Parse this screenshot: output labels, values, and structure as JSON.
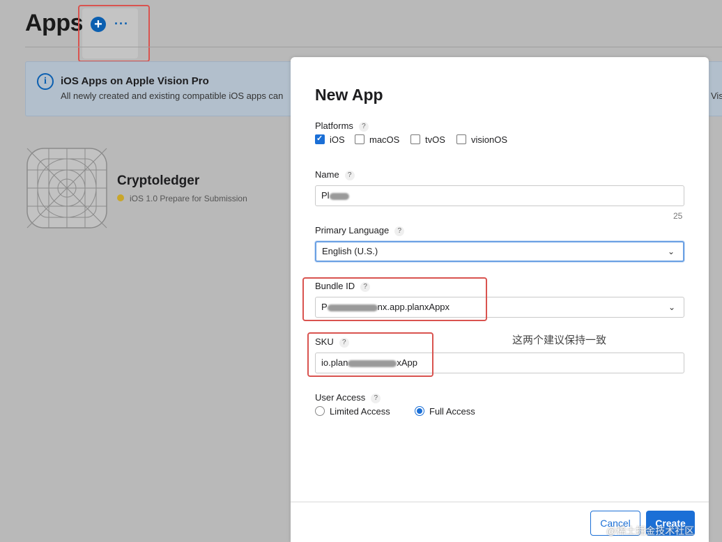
{
  "page": {
    "title": "Apps"
  },
  "header": {
    "add_symbol": "+",
    "more_symbol": "···"
  },
  "banner": {
    "title": "iOS Apps on Apple Vision Pro",
    "text": "All newly created and existing compatible iOS apps can",
    "text_right": "Vis"
  },
  "app": {
    "name": "Cryptoledger",
    "status": "iOS 1.0 Prepare for Submission"
  },
  "modal": {
    "title": "New App",
    "platforms_label": "Platforms",
    "platforms": [
      {
        "label": "iOS",
        "checked": true
      },
      {
        "label": "macOS",
        "checked": false
      },
      {
        "label": "tvOS",
        "checked": false
      },
      {
        "label": "visionOS",
        "checked": false
      }
    ],
    "name_label": "Name",
    "name_value": "Pl",
    "name_counter": "25",
    "language_label": "Primary Language",
    "language_value": "English (U.S.)",
    "bundle_label": "Bundle ID",
    "bundle_prefix": "P",
    "bundle_value": "nx.app.planxAppx",
    "sku_label": "SKU",
    "sku_prefix": "io.plan",
    "sku_value": "xApp",
    "access_label": "User Access",
    "access_options": [
      {
        "label": "Limited Access",
        "selected": false
      },
      {
        "label": "Full Access",
        "selected": true
      }
    ],
    "help_symbol": "?",
    "cancel_label": "Cancel",
    "create_label": "Create"
  },
  "note": "这两个建议保持一致",
  "watermark": "@稀土掘金技术社区",
  "colors": {
    "accent": "#1b6fd6",
    "highlight": "#d9534f",
    "status_dot": "#c9a62a"
  }
}
